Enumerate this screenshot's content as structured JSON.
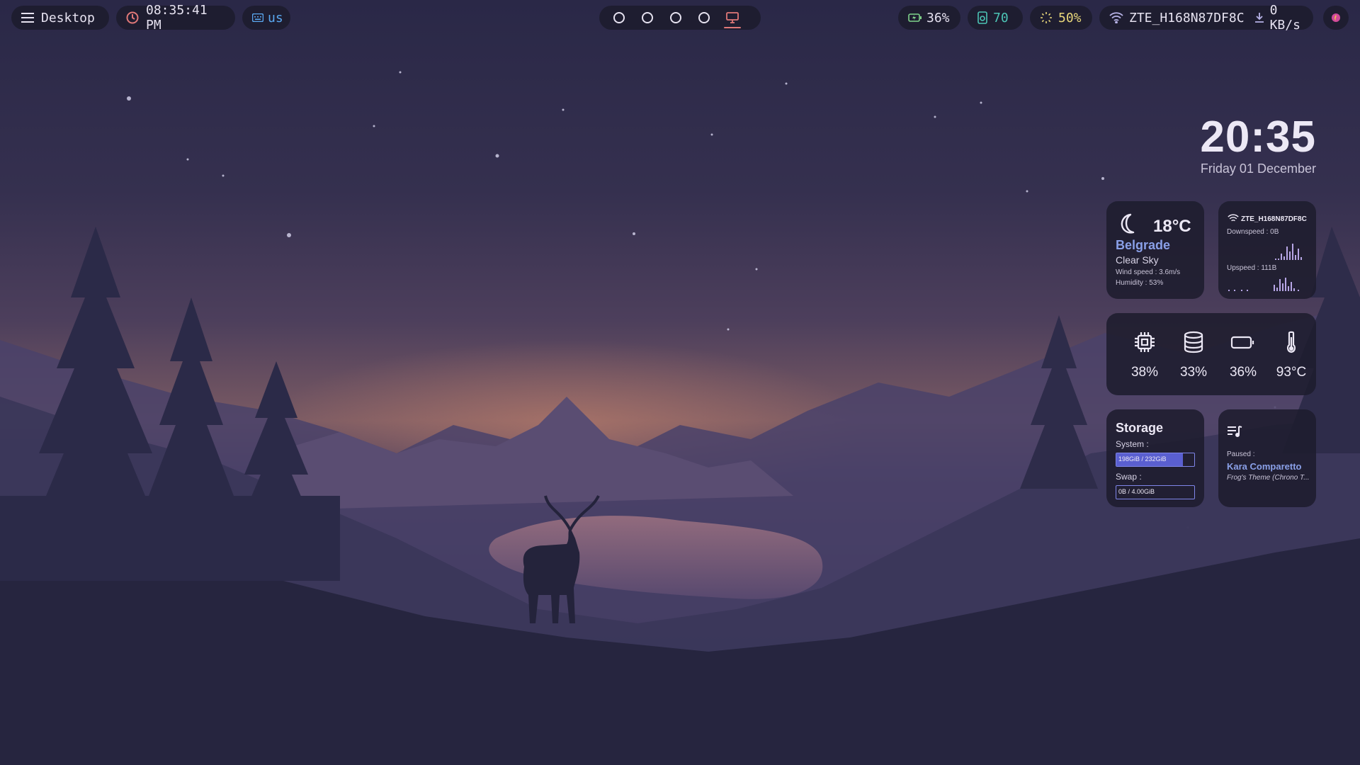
{
  "topbar": {
    "menu_label": "Desktop",
    "time": "08:35:41 PM",
    "keyboard_layout": "us",
    "workspaces": [
      {
        "icon": "circle-icon",
        "active": false
      },
      {
        "icon": "circle-icon",
        "active": false
      },
      {
        "icon": "circle-icon",
        "active": false
      },
      {
        "icon": "circle-icon",
        "active": false
      },
      {
        "icon": "monitor-icon",
        "active": true
      }
    ],
    "battery": "36%",
    "memory": "70",
    "brightness": "50%",
    "wifi_ssid": "ZTE_H168N87DF8C",
    "download_speed": "0 KB/s",
    "colors": {
      "battery": "#7fd38a",
      "memory": "#4cc5b5",
      "brightness": "#e8d77a",
      "accent": "#e07878",
      "blue": "#5aa8f0"
    }
  },
  "clock": {
    "time": "20:35",
    "date": "Friday 01 December"
  },
  "weather": {
    "temperature": "18°C",
    "city": "Belgrade",
    "condition": "Clear Sky",
    "wind": "Wind speed : 3.6m/s",
    "humidity": "Humidity : 53%"
  },
  "network": {
    "ssid": "ZTE_H168N87DF8C",
    "downspeed": "Downspeed : 0B",
    "upspeed": "Upspeed : 111B"
  },
  "stats": {
    "cpu": "38%",
    "ram": "33%",
    "battery": "36%",
    "temperature": "93°C"
  },
  "storage": {
    "title": "Storage",
    "system_label": "System :",
    "system_value": "198GiB / 232GiB",
    "system_fraction": 0.85,
    "swap_label": "Swap :",
    "swap_value": "0B / 4.00GiB",
    "swap_fraction": 0.0
  },
  "music": {
    "status": "Paused :",
    "artist": "Kara Comparetto",
    "title": "Frog's Theme (Chrono T..."
  }
}
